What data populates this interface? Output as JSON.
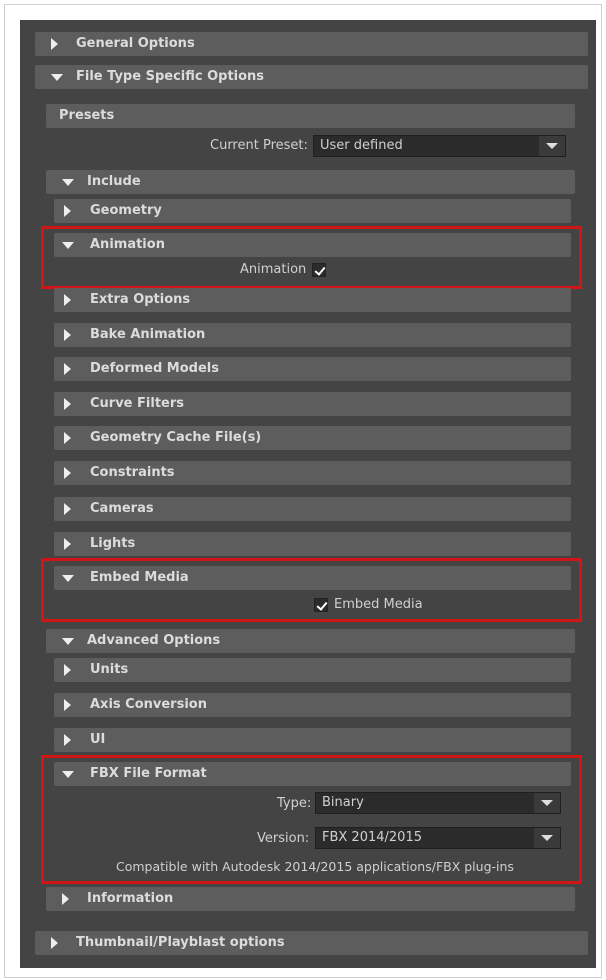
{
  "sections": {
    "general_options": "General Options",
    "file_type_specific": "File Type Specific Options",
    "presets": "Presets",
    "include": "Include",
    "geometry": "Geometry",
    "animation": "Animation",
    "extra_options": "Extra Options",
    "bake_animation": "Bake Animation",
    "deformed_models": "Deformed Models",
    "curve_filters": "Curve Filters",
    "geometry_cache": "Geometry Cache File(s)",
    "constraints": "Constraints",
    "cameras": "Cameras",
    "lights": "Lights",
    "embed_media": "Embed Media",
    "advanced_options": "Advanced Options",
    "units": "Units",
    "axis_conversion": "Axis Conversion",
    "ui": "UI",
    "fbx_file_format": "FBX File Format",
    "information": "Information",
    "thumbnail_options": "Thumbnail/Playblast options"
  },
  "presets": {
    "current_preset_label": "Current Preset:",
    "current_preset_value": "User defined"
  },
  "animation": {
    "checkbox_label": "Animation",
    "checked": true
  },
  "embed_media": {
    "checkbox_label": "Embed Media",
    "checked": true
  },
  "fbx_format": {
    "type_label": "Type:",
    "type_value": "Binary",
    "version_label": "Version:",
    "version_value": "FBX 2014/2015",
    "compat_note": "Compatible with Autodesk 2014/2015 applications/FBX plug-ins"
  },
  "colors": {
    "panel_bg": "#444444",
    "header_bg": "#5d5d5d",
    "highlight": "#d11414",
    "field_bg": "#2b2b2b"
  },
  "icons": [
    "expand-arrow-right-icon",
    "collapse-arrow-down-icon",
    "checkmark-icon",
    "dropdown-arrow-icon"
  ]
}
